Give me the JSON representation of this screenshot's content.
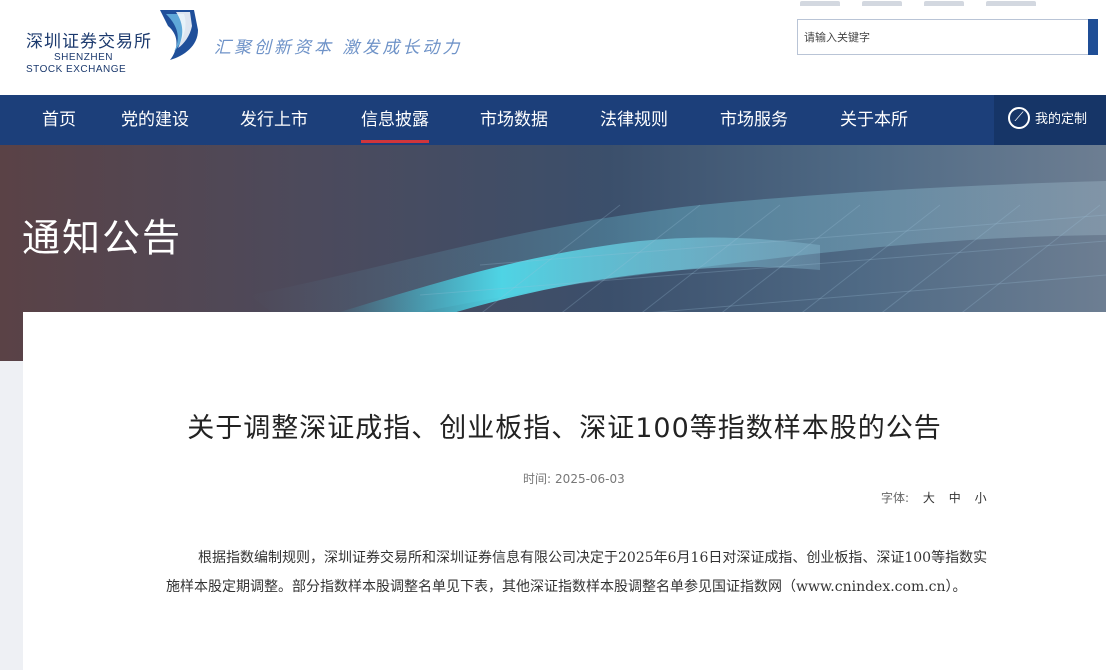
{
  "header": {
    "logo_cn": "深圳证券交易所",
    "logo_en_line1": "SHENZHEN",
    "logo_en_line2": "STOCK EXCHANGE",
    "slogan": "汇聚创新资本 激发成长动力",
    "search_placeholder": "请输入关键字"
  },
  "nav": {
    "items": [
      "首页",
      "党的建设",
      "发行上市",
      "信息披露",
      "市场数据",
      "法律规则",
      "市场服务",
      "关于本所"
    ],
    "active": "信息披露",
    "my_custom": "我的定制"
  },
  "banner": {
    "title": "通知公告"
  },
  "article": {
    "title": "关于调整深证成指、创业板指、深证100等指数样本股的公告",
    "time_label": "时间:",
    "time_value": "2025-06-03",
    "font_label": "字体:",
    "font_large": "大",
    "font_medium": "中",
    "font_small": "小",
    "body": "根据指数编制规则，深圳证券交易所和深圳证券信息有限公司决定于2025年6月16日对深证成指、创业板指、深证100等指数实施样本股定期调整。部分指数样本股调整名单见下表，其他深证指数样本股调整名单参见国证指数网（www.cnindex.com.cn）。"
  },
  "colors": {
    "nav_bg": "#1c3f7a",
    "active_underline": "#d0353b",
    "slogan": "#6f93c8"
  }
}
